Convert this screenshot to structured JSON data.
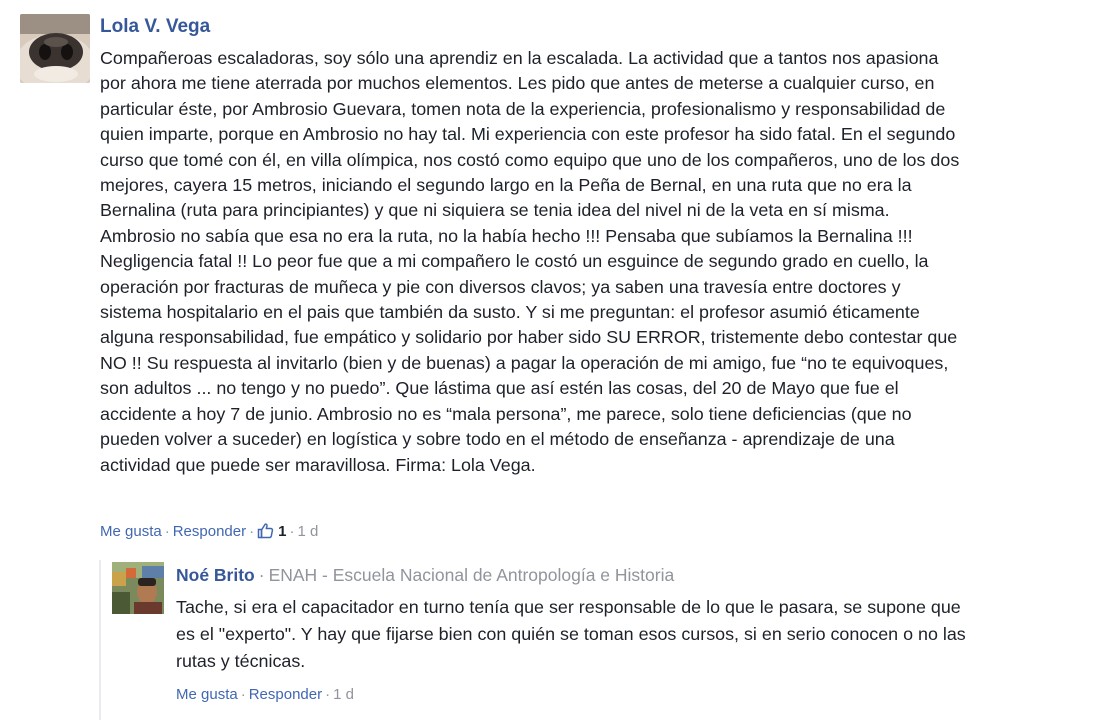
{
  "comment": {
    "author": "Lola V. Vega",
    "lines": [
      "Compañeroas escaladoras, soy sólo una aprendiz en la escalada. La actividad que a tantos nos apasiona",
      "por ahora me tiene aterrada por muchos elementos. Les pido que antes de meterse a cualquier curso, en",
      "particular éste, por Ambrosio Guevara, tomen nota de la experiencia, profesionalismo y responsabilidad de",
      "quien imparte, porque en Ambrosio no hay tal. Mi experiencia con este profesor ha sido fatal. En el segundo",
      "curso que tomé con él, en villa olímpica, nos costó como equipo que uno de los compañeros, uno de los dos",
      "mejores, cayera 15 metros, iniciando el segundo largo en la Peña de Bernal, en una ruta que no era la",
      "Bernalina (ruta para principiantes) y que ni siquiera se tenia idea del nivel ni de la veta en sí misma.",
      "Ambrosio no sabía que esa no era la ruta, no la había hecho !!! Pensaba que subíamos la Bernalina !!!",
      "Negligencia fatal !! Lo peor fue que a mi compañero le costó un esguince de segundo grado en cuello, la",
      "operación por fracturas de muñeca y pie con diversos clavos; ya saben una travesía entre doctores y",
      "sistema hospitalario en el pais que también da susto. Y si me preguntan: el profesor asumió éticamente",
      "alguna responsabilidad, fue empático y solidario por haber sido SU ERROR, tristemente debo contestar que",
      "NO !! Su respuesta al invitarlo (bien y de buenas) a pagar la operación de mi amigo, fue “no te equivoques,",
      "son adultos ... no tengo y no puedo”. Que lástima que así estén las cosas, del 20 de Mayo que fue el",
      "accidente a hoy 7 de junio. Ambrosio no es “mala persona”, me parece, solo tiene deficiencias (que no",
      "pueden volver a suceder) en logística y sobre todo en el método de enseñanza - aprendizaje de una",
      "actividad que puede ser maravillosa. Firma: Lola Vega."
    ],
    "actions": {
      "like": "Me gusta",
      "reply": "Responder",
      "like_count": "1",
      "time": "1 d"
    }
  },
  "reply": {
    "author": "Noé Brito",
    "organization": "ENAH - Escuela Nacional de Antropología e Historia",
    "lines": [
      "Tache, si era el capacitador en turno tenía que ser responsable de lo que le pasara, se supone que",
      "es el \"experto\". Y hay que fijarse bien con quién se toman esos cursos, si en serio conocen o no las",
      "rutas y técnicas."
    ],
    "actions": {
      "like": "Me gusta",
      "reply": "Responder",
      "time": "1 d"
    }
  },
  "colors": {
    "link": "#365899",
    "action_link": "#4267b2",
    "meta": "#90949c",
    "text": "#1d2129"
  }
}
